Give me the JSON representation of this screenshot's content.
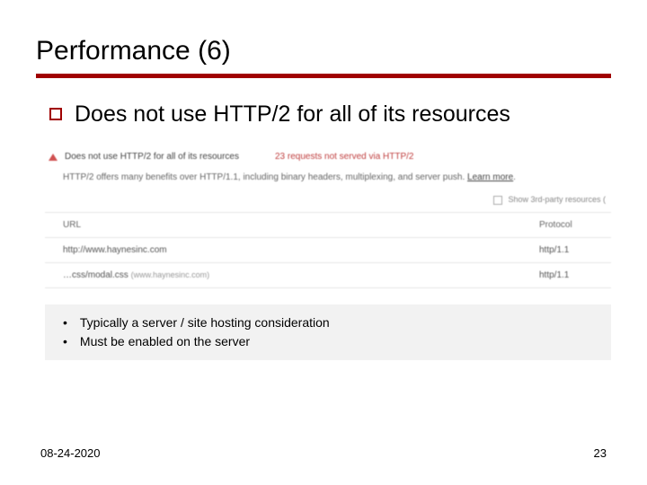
{
  "title": "Performance (6)",
  "main_bullet": "Does not use HTTP/2 for all of its resources",
  "audit": {
    "header_title": "Does not use HTTP/2 for all of its resources",
    "header_count": "23 requests not served via HTTP/2",
    "description": "HTTP/2 offers many benefits over HTTP/1.1, including binary headers, multiplexing, and server push. ",
    "learn_more": "Learn more",
    "third_party_label": "Show 3rd-party resources (",
    "columns": {
      "url": "URL",
      "protocol": "Protocol"
    },
    "rows": [
      {
        "url": "http://www.haynesinc.com",
        "domain": "",
        "protocol": "http/1.1"
      },
      {
        "url": "…css/modal.css",
        "domain": "(www.haynesinc.com)",
        "protocol": "http/1.1"
      }
    ]
  },
  "sub_bullets": [
    "Typically a server / site hosting consideration",
    "Must be enabled on the server"
  ],
  "footer": {
    "date": "08-24-2020",
    "page": "23"
  }
}
